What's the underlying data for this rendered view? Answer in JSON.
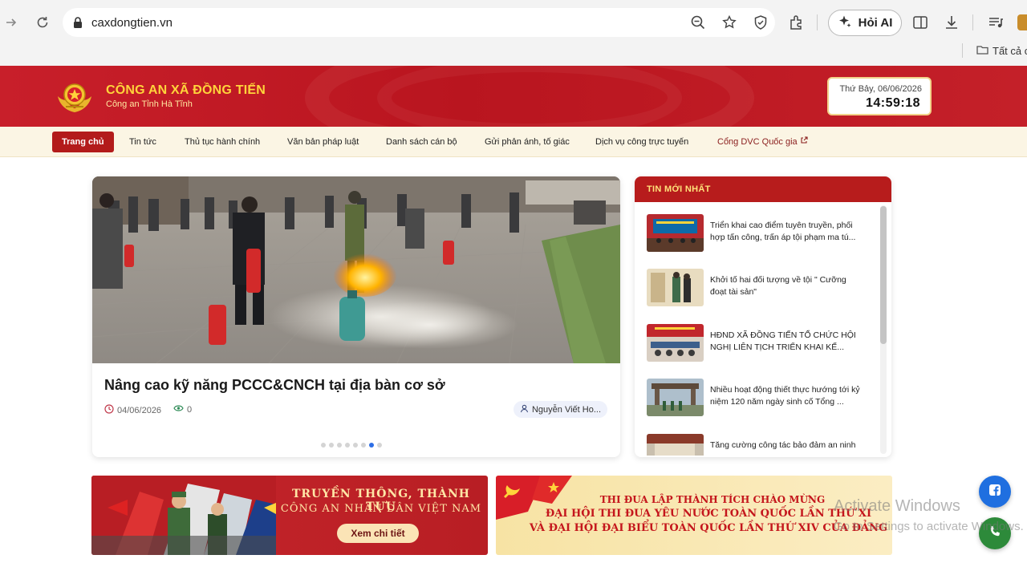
{
  "browser": {
    "url": "caxdongtien.vn",
    "ai_button_label": "Hỏi AI",
    "bookmarks_label": "Tất cả c"
  },
  "header": {
    "title": "CÔNG AN XÃ ĐỒNG TIẾN",
    "subtitle": "Công an Tỉnh Hà Tĩnh",
    "clock_date": "Thứ Bảy, 06/06/2026",
    "clock_time": "14:59:18"
  },
  "nav": {
    "items": [
      {
        "label": "Trang chủ"
      },
      {
        "label": "Tin tức"
      },
      {
        "label": "Thủ tục hành chính"
      },
      {
        "label": "Văn bản pháp luật"
      },
      {
        "label": "Danh sách cán bộ"
      },
      {
        "label": "Gửi phản ánh, tố giác"
      },
      {
        "label": "Dịch vụ công trực tuyến"
      },
      {
        "label": "Cổng DVC Quốc gia"
      }
    ]
  },
  "featured": {
    "title": "Nâng cao kỹ năng PCCC&CNCH tại địa bàn cơ sở",
    "date": "04/06/2026",
    "views": "0",
    "author": "Nguyễn Viết Ho...",
    "slide_count": 8,
    "active_slide": 7
  },
  "latest": {
    "heading": "TIN MỚI NHẤT",
    "items": [
      {
        "title": "Triển khai cao điểm tuyên truyền, phối hợp tấn công, trấn áp tội phạm ma tú..."
      },
      {
        "title": "Khởi tố hai đối tượng về tội \" Cưỡng đoạt tài sản\""
      },
      {
        "title": "HĐND XÃ ĐỒNG TIẾN TỔ CHỨC HỘI NGHỊ LIÊN TỊCH TRIỂN KHAI KẾ..."
      },
      {
        "title": "Nhiều hoạt động thiết thực hướng tới kỷ niệm 120 năm ngày sinh cố Tổng ..."
      },
      {
        "title": "Tăng cường công tác bảo đảm an ninh"
      }
    ]
  },
  "banners": {
    "left": {
      "line1": "TRUYỀN THÔNG, THÀNH TỰU",
      "line2": "CÔNG AN NHÂN DÂN VIỆT NAM",
      "button": "Xem chi tiết"
    },
    "right": {
      "line1": "THI ĐUA LẬP THÀNH TÍCH CHÀO MỪNG",
      "line2": "ĐẠI HỘI THI ĐUA YÊU NƯỚC TOÀN QUỐC LẦN THỨ XI",
      "line3": "VÀ ĐẠI HỘI ĐẠI BIỂU TOÀN QUỐC LẦN THỨ XIV CỦA ĐẢNG"
    }
  },
  "watermark": {
    "line1": "Activate Windows",
    "line2": "Go to Settings to activate Windows."
  },
  "colors": {
    "brand_red": "#b71c1c",
    "gold": "#ffd43b",
    "nav_bg": "#fbf5e4",
    "accent_blue": "#2d6ee6"
  }
}
